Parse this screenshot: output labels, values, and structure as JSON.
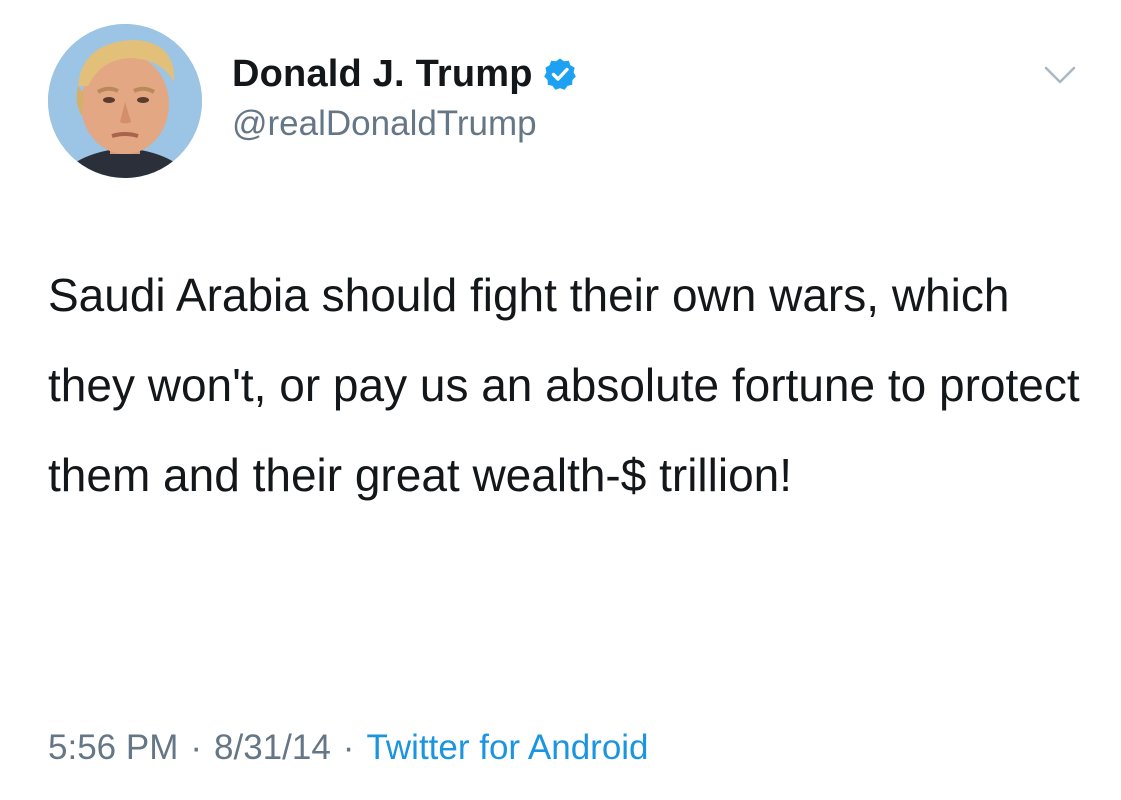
{
  "tweet": {
    "author": {
      "display_name": "Donald J. Trump",
      "handle": "@realDonaldTrump",
      "verified": true
    },
    "text": "Saudi Arabia should fight their own wars, which they won't, or pay us an absolute fortune to protect them and their great wealth-$ trillion!",
    "meta": {
      "time": "5:56 PM",
      "separator": "·",
      "date": "8/31/14",
      "source": "Twitter for Android"
    },
    "colors": {
      "text": "#14171a",
      "secondary": "#657786",
      "link": "#1b95e0",
      "verified": "#1da1f2"
    },
    "icons": {
      "verified": "verified-badge-icon",
      "menu": "chevron-down-icon"
    }
  }
}
